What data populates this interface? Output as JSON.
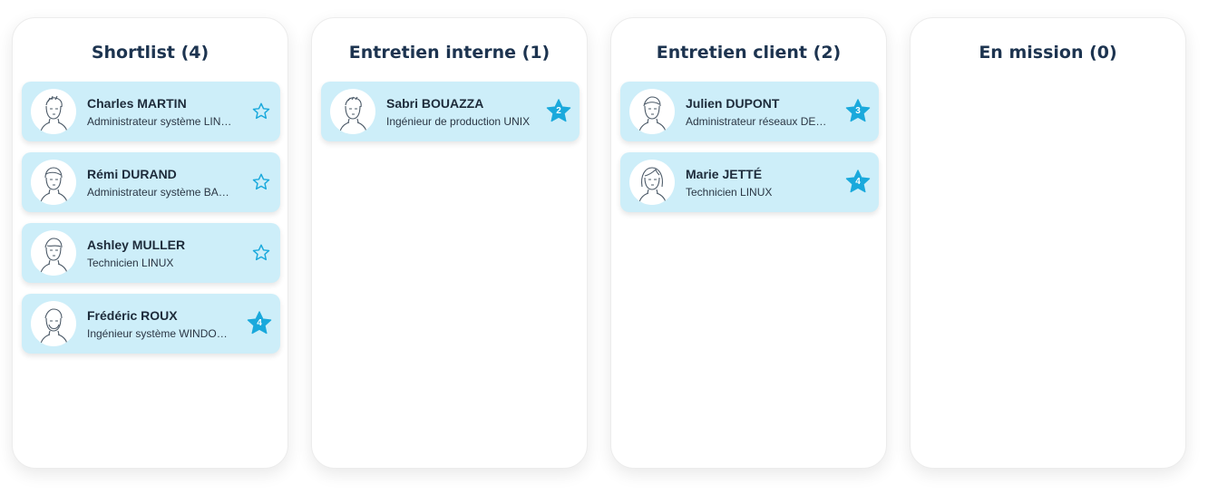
{
  "accent_color": "#1aa9dc",
  "card_color": "#cdeef9",
  "columns": [
    {
      "title": "Shortlist (4)",
      "cards": [
        {
          "name": "Charles MARTIN",
          "role": "Administrateur système LINUX",
          "rating": "",
          "star": "outline"
        },
        {
          "name": "Rémi DURAND",
          "role": "Administrateur système BASH",
          "rating": "",
          "star": "outline"
        },
        {
          "name": "Ashley MULLER",
          "role": "Technicien LINUX",
          "rating": "",
          "star": "outline"
        },
        {
          "name": "Frédéric ROUX",
          "role": "Ingénieur système WINDOWS",
          "rating": "4",
          "star": "filled"
        }
      ]
    },
    {
      "title": "Entretien interne (1)",
      "cards": [
        {
          "name": "Sabri BOUAZZA",
          "role": "Ingénieur de production UNIX",
          "rating": "2",
          "star": "filled"
        }
      ]
    },
    {
      "title": "Entretien client (2)",
      "cards": [
        {
          "name": "Julien DUPONT",
          "role": "Administrateur réseaux DEBIAN",
          "rating": "3",
          "star": "filled"
        },
        {
          "name": "Marie JETTÉ",
          "role": "Technicien LINUX",
          "rating": "4",
          "star": "filled"
        }
      ]
    },
    {
      "title": "En mission (0)",
      "cards": []
    }
  ]
}
